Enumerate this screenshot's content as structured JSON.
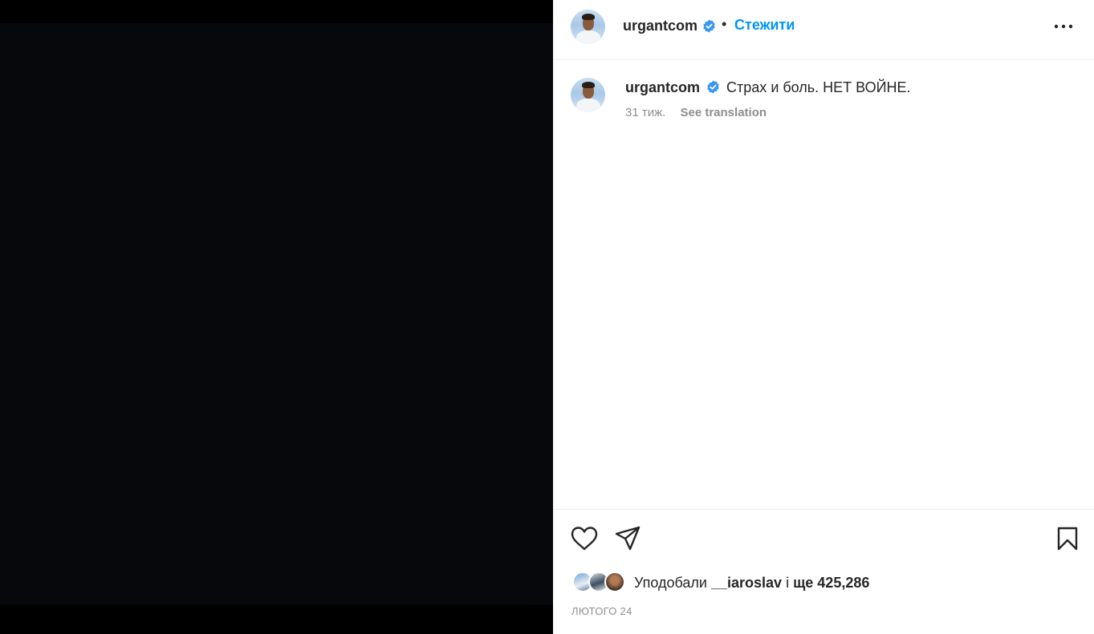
{
  "post": {
    "author": "urgantcom",
    "follow_label": "Стежити",
    "separator": "•",
    "caption": "Страх и боль. НЕТ ВОЙНЕ.",
    "time_ago": "31 тиж.",
    "see_translation": "See translation",
    "likes": {
      "prefix": "Уподобали",
      "liked_by": "__iaroslav",
      "conjunction": "і",
      "others": "ще 425,286"
    },
    "date": "лютого 24"
  },
  "icons": {
    "verified": "verified-badge-icon",
    "more": "more-options-icon",
    "like": "heart-icon",
    "share": "paper-plane-icon",
    "save": "bookmark-icon"
  },
  "colors": {
    "accent": "#0095f6",
    "verified": "#3897f0",
    "text": "#262626",
    "secondary": "#8e8e8e",
    "media_bg": "#07080c"
  }
}
